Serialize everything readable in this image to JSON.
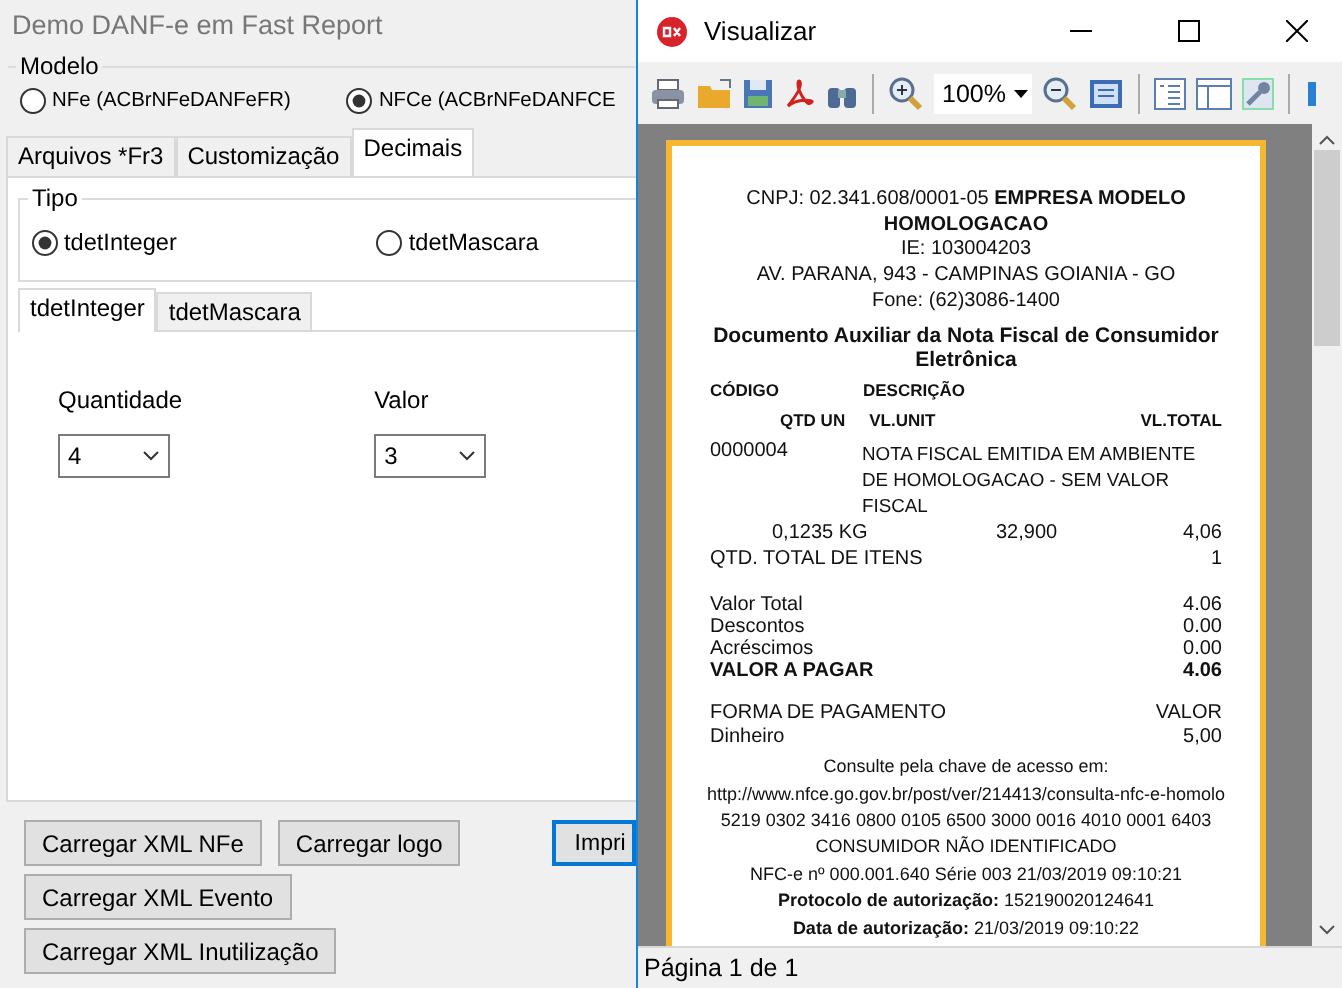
{
  "main_window": {
    "title": "Demo DANF-e em Fast Report",
    "modelo": {
      "label": "Modelo",
      "options": [
        {
          "label": "NFe (ACBrNFeDANFeFR)",
          "selected": false
        },
        {
          "label": "NFCe (ACBrNFeDANFCE",
          "selected": true
        }
      ]
    },
    "tabs": [
      {
        "label": "Arquivos *Fr3",
        "selected": false
      },
      {
        "label": "Customização",
        "selected": false
      },
      {
        "label": "Decimais",
        "selected": true
      }
    ],
    "tipo": {
      "label": "Tipo",
      "options": [
        {
          "label": "tdetInteger",
          "selected": true
        },
        {
          "label": "tdetMascara",
          "selected": false
        }
      ]
    },
    "sub_tabs": [
      {
        "label": "tdetInteger",
        "selected": true
      },
      {
        "label": "tdetMascara",
        "selected": false
      }
    ],
    "fields": [
      {
        "label": "Quantidade",
        "value": "4"
      },
      {
        "label": "Valor",
        "value": "3"
      }
    ],
    "button_rows": [
      [
        {
          "label": "Carregar XML NFe",
          "default": false
        },
        {
          "label": "Carregar logo",
          "default": false
        },
        {
          "label": "Impri",
          "default": true
        }
      ],
      [
        {
          "label": "Carregar XML Evento",
          "default": false
        }
      ],
      [
        {
          "label": "Carregar XML Inutilização",
          "default": false
        }
      ]
    ]
  },
  "preview_window": {
    "title": "Visualizar",
    "zoom": "100%",
    "status_bar": "Página 1 de 1",
    "receipt": {
      "header": [
        "CNPJ: 02.341.608/0001-05 **EMPRESA MODELO HOMOLOGACAO**",
        "IE: 103004203",
        "AV. PARANA, 943 - CAMPINAS GOIANIA - GO",
        "Fone: (62)3086-1400"
      ],
      "title": "Documento Auxiliar da Nota Fiscal de Consumidor Eletrônica",
      "columns": {
        "code": "CÓDIGO",
        "description": "DESCRIÇÃO",
        "quantity": "QTD UN",
        "unit_price": "VL.UNIT",
        "total": "VL.TOTAL"
      },
      "items": [
        {
          "code": "0000004",
          "description": "NOTA FISCAL EMITIDA EM AMBIENTE DE HOMOLOGACAO - SEM VALOR FISCAL",
          "quantity": "0,1235 KG",
          "unit_price": "32,900",
          "total": "4,06"
        }
      ],
      "item_count": {
        "label": "QTD. TOTAL DE ITENS",
        "value": "1"
      },
      "totals": [
        {
          "label": "Valor Total",
          "value": "4.06",
          "bold": false
        },
        {
          "label": "Descontos",
          "value": "0.00",
          "bold": false
        },
        {
          "label": "Acréscimos",
          "value": "0.00",
          "bold": false
        },
        {
          "label": "VALOR A PAGAR",
          "value": "4.06",
          "bold": true
        }
      ],
      "payment_header": {
        "label": "FORMA DE PAGAMENTO",
        "value": "VALOR"
      },
      "payments": [
        {
          "label": "Dinheiro",
          "value": "5,00"
        }
      ],
      "footer": [
        "Consulte pela chave de acesso em:",
        "http://www.nfce.go.gov.br/post/ver/214413/consulta-nfc-e-homolo",
        "5219 0302 3416 0800 0105 6500 3000 0016 4010 0001 6403",
        "CONSUMIDOR NÃO IDENTIFICADO",
        "NFC-e nº 000.001.640 Série 003 21/03/2019 09:10:21",
        "**Protocolo de autorização:** 152190020124641",
        "**Data de autorização:** 21/03/2019 09:10:22"
      ]
    }
  }
}
